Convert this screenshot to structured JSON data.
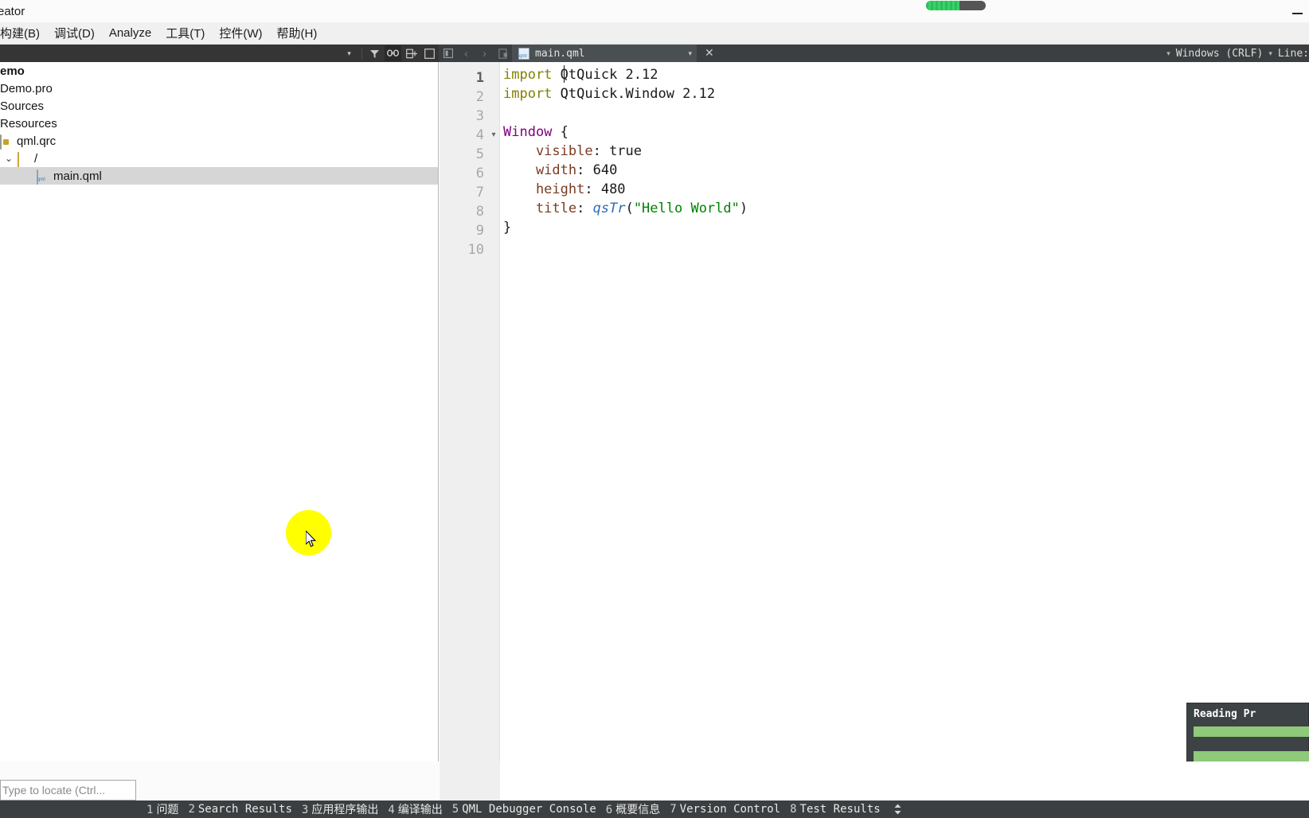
{
  "window": {
    "title": "reator",
    "minimize_label": "minimize",
    "progress_pct": 56
  },
  "menubar": {
    "items": [
      {
        "label": "构建(B)"
      },
      {
        "label": "调试(D)"
      },
      {
        "label": "Analyze"
      },
      {
        "label": "工具(T)"
      },
      {
        "label": "控件(W)"
      },
      {
        "label": "帮助(H)"
      }
    ]
  },
  "project_toolbar": {
    "dropdown_caret": "▾",
    "filter_icon": "filter-icon",
    "link_icon": "link-icon",
    "split_icon": "split-icon"
  },
  "editor_toolbar": {
    "back_label": "‹",
    "forward_label": "›",
    "tab_label": "main.qml",
    "tab_caret": "▾",
    "close_label": "✕",
    "encoding_caret": "▾",
    "line_ending": "Windows (CRLF)",
    "line_ending_caret": "▾",
    "line_label": "Line:"
  },
  "project_tree": {
    "rows": [
      {
        "label": "emo",
        "indent": 0,
        "bold": true,
        "icon": "none",
        "twisty": "",
        "selected": false
      },
      {
        "label": "Demo.pro",
        "indent": 1,
        "bold": false,
        "icon": "none",
        "twisty": "",
        "selected": false
      },
      {
        "label": "Sources",
        "indent": 1,
        "bold": false,
        "icon": "none",
        "twisty": "",
        "selected": false
      },
      {
        "label": "Resources",
        "indent": 1,
        "bold": false,
        "icon": "none",
        "twisty": "",
        "selected": false
      },
      {
        "label": "qml.qrc",
        "indent": 1,
        "bold": false,
        "icon": "qrc",
        "twisty": "",
        "selected": false
      },
      {
        "label": "/",
        "indent": 1,
        "bold": false,
        "icon": "folder",
        "twisty": "⌄",
        "selected": false
      },
      {
        "label": "main.qml",
        "indent": 3,
        "bold": false,
        "icon": "qml",
        "twisty": "",
        "selected": true
      }
    ]
  },
  "code": {
    "caret_line": 1,
    "lines": [
      {
        "num": "1",
        "fold": "",
        "tokens": [
          {
            "t": "import",
            "c": "kw"
          },
          {
            "t": " QtQuick 2.12",
            "c": "plain"
          }
        ]
      },
      {
        "num": "2",
        "fold": "",
        "tokens": [
          {
            "t": "import",
            "c": "kw"
          },
          {
            "t": " QtQuick.Window 2.12",
            "c": "plain"
          }
        ]
      },
      {
        "num": "3",
        "fold": "",
        "tokens": []
      },
      {
        "num": "4",
        "fold": "▾",
        "tokens": [
          {
            "t": "Window",
            "c": "type"
          },
          {
            "t": " {",
            "c": "plain"
          }
        ]
      },
      {
        "num": "5",
        "fold": "",
        "tokens": [
          {
            "t": "    visible",
            "c": "prop"
          },
          {
            "t": ": true",
            "c": "plain"
          }
        ]
      },
      {
        "num": "6",
        "fold": "",
        "tokens": [
          {
            "t": "    width",
            "c": "prop"
          },
          {
            "t": ": 640",
            "c": "plain"
          }
        ]
      },
      {
        "num": "7",
        "fold": "",
        "tokens": [
          {
            "t": "    height",
            "c": "prop"
          },
          {
            "t": ": 480",
            "c": "plain"
          }
        ]
      },
      {
        "num": "8",
        "fold": "",
        "tokens": [
          {
            "t": "    title",
            "c": "prop"
          },
          {
            "t": ": ",
            "c": "plain"
          },
          {
            "t": "qsTr",
            "c": "fn"
          },
          {
            "t": "(",
            "c": "plain"
          },
          {
            "t": "\"Hello World\"",
            "c": "str"
          },
          {
            "t": ")",
            "c": "plain"
          }
        ]
      },
      {
        "num": "9",
        "fold": "",
        "tokens": [
          {
            "t": "}",
            "c": "plain"
          }
        ]
      },
      {
        "num": "10",
        "fold": "",
        "tokens": []
      }
    ]
  },
  "reading_popup": {
    "title": "Reading Pr"
  },
  "locator": {
    "placeholder": "Type to locate (Ctrl..."
  },
  "status_tabs": [
    {
      "num": "1",
      "label": "问题"
    },
    {
      "num": "2",
      "label": "Search Results"
    },
    {
      "num": "3",
      "label": "应用程序输出"
    },
    {
      "num": "4",
      "label": "编译输出"
    },
    {
      "num": "5",
      "label": "QML Debugger Console"
    },
    {
      "num": "6",
      "label": "概要信息"
    },
    {
      "num": "7",
      "label": "Version Control"
    },
    {
      "num": "8",
      "label": "Test Results"
    }
  ],
  "colors": {
    "toolbar_dark": "#353535",
    "toolbar_tab": "#4a4f52",
    "statusbar": "#3b3f41",
    "selection": "#d6d6d6",
    "progress_green": "#8fc97a",
    "keyword": "#808000",
    "type": "#800080",
    "property": "#7a3b22",
    "function": "#2b6db5",
    "string": "#008000",
    "click_highlight": "#ffff00"
  }
}
